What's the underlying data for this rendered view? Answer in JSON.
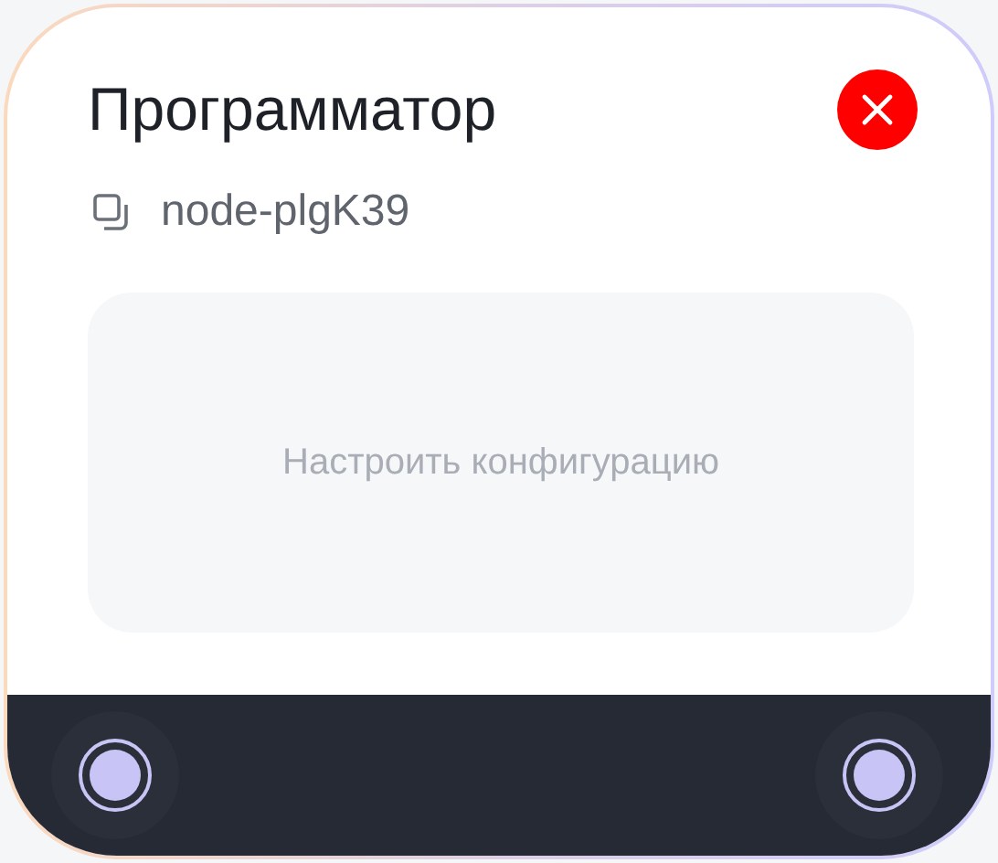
{
  "node": {
    "title": "Программатор",
    "id": "node-plgK39",
    "config_button": "Настроить конфигурацию"
  }
}
